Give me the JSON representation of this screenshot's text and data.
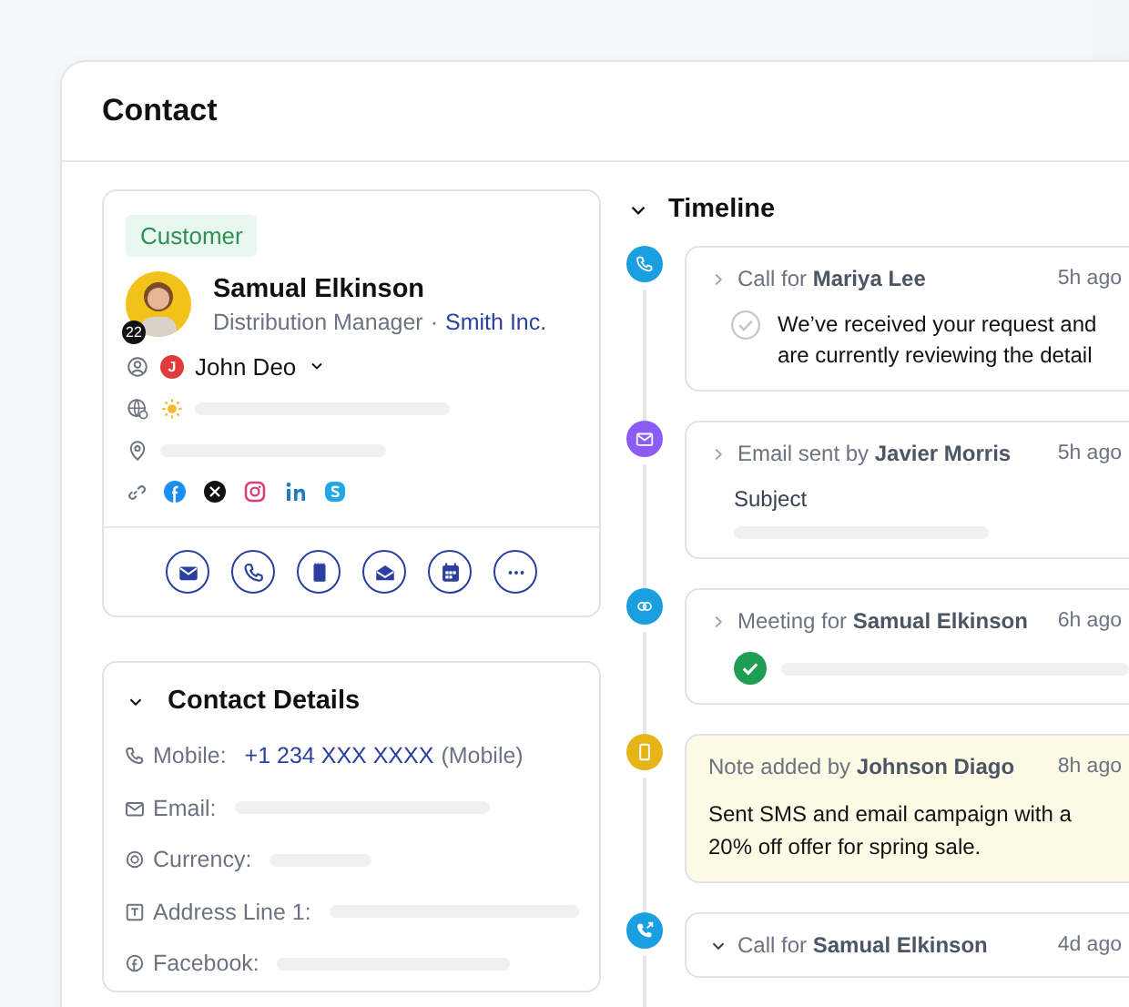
{
  "window": {
    "title": "Contact"
  },
  "profile": {
    "tag": "Customer",
    "badge": "22",
    "name": "Samual Elkinson",
    "role": "Distribution Manager",
    "separator": "·",
    "company": "Smith Inc.",
    "owner": {
      "initial": "J",
      "name": "John Deo"
    },
    "actions": [
      {
        "kind": "mail"
      },
      {
        "kind": "phone"
      },
      {
        "kind": "notebook"
      },
      {
        "kind": "mail-open"
      },
      {
        "kind": "calendar"
      },
      {
        "kind": "more"
      }
    ]
  },
  "contact_details": {
    "title": "Contact Details",
    "expanded": true,
    "fields": [
      {
        "label": "Mobile:",
        "kind": "link",
        "value": "+1 234 XXX XXXX",
        "note": "(Mobile)"
      },
      {
        "label": "Email:",
        "kind": "placeholder"
      },
      {
        "label": "Currency:",
        "kind": "placeholder"
      },
      {
        "label": "Address Line 1:",
        "kind": "placeholder"
      },
      {
        "label": "Facebook:",
        "kind": "placeholder"
      }
    ]
  },
  "timeline": {
    "title": "Timeline",
    "expanded": true,
    "items": [
      {
        "kind": "call",
        "title": "Call for **Mariya Lee**",
        "time": "5h ago",
        "expanded": false,
        "lines": [
          "We’ve received your request and",
          "are currently reviewing the detail"
        ]
      },
      {
        "kind": "email",
        "title": "Email sent by **Javier Morris**",
        "time": "5h ago",
        "expanded": false,
        "subject": "Subject"
      },
      {
        "kind": "meeting",
        "title": "Meeting for **Samual Elkinson**",
        "time": "6h ago",
        "expanded": false
      },
      {
        "kind": "note",
        "title": "Note added by **Johnson Diago**",
        "time": "8h ago",
        "lines": [
          "Sent SMS and email campaign with a",
          "20% off offer for spring sale."
        ]
      },
      {
        "kind": "call-out",
        "title": "Call for **Samual Elkinson**",
        "time": "4d ago",
        "expanded": true
      }
    ]
  }
}
